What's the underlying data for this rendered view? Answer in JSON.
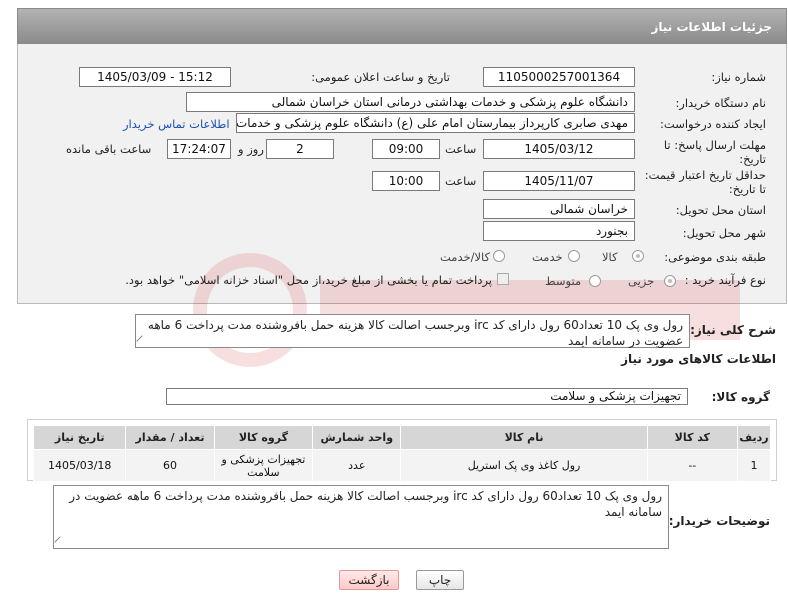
{
  "header": {
    "title": "جزئیات اطلاعات نیاز"
  },
  "need_number": {
    "label": "شماره نیاز:",
    "value": "1105000257001364"
  },
  "announce_datetime": {
    "label": "تاریخ و ساعت اعلان عمومی:",
    "value": "1405/03/09 - 15:12"
  },
  "buyer_org": {
    "label": "نام دستگاه خریدار:",
    "value": "دانشگاه علوم پزشکی و خدمات بهداشتی درمانی استان خراسان شمالی"
  },
  "requester": {
    "label": "ایجاد کننده درخواست:",
    "value": "مهدی صابری کارپرداز بیمارستان امام علی (ع) دانشگاه علوم پزشکی و خدمات ب",
    "contact_link": "اطلاعات تماس خریدار"
  },
  "reply_deadline": {
    "label": "مهلت ارسال پاسخ: تا تاریخ:",
    "date": "1405/03/12",
    "time_label": "ساعت",
    "time": "09:00",
    "days": "2",
    "days_label": "روز و",
    "remaining": "17:24:07",
    "remaining_label": "ساعت باقی مانده"
  },
  "price_validity": {
    "label": "حداقل تاریخ اعتبار قیمت: تا تاریخ:",
    "date": "1405/11/07",
    "time_label": "ساعت",
    "time": "10:00"
  },
  "delivery_province": {
    "label": "استان محل تحویل:",
    "value": "خراسان شمالی"
  },
  "delivery_city": {
    "label": "شهر محل تحویل:",
    "value": "بجنورد"
  },
  "category": {
    "label": "طبقه بندی موضوعی:",
    "options": [
      "کالا",
      "خدمت",
      "کالا/خدمت"
    ],
    "selected": "کالا"
  },
  "process_type": {
    "label": "نوع فرآیند خرید :",
    "options": [
      "جزیی",
      "متوسط"
    ],
    "selected": "جزیی",
    "treasury_note": "پرداخت تمام یا بخشی از مبلغ خرید،از محل \"اسناد خزانه اسلامی\" خواهد بود."
  },
  "general_description": {
    "label": "شرح کلی نیاز:",
    "value": "رول وی پک 10 تعداد60 رول دارای کد irc وبرجسب اصالت کالا هزینه حمل بافروشنده مدت پرداخت 6 ماهه عضویت در سامانه ایمد"
  },
  "goods_info_title": "اطلاعات کالاهای مورد نیاز",
  "goods_group": {
    "label": "گروه کالا:",
    "value": "تجهیزات پزشکی و سلامت"
  },
  "table": {
    "headers": [
      "ردیف",
      "کد کالا",
      "نام کالا",
      "واحد شمارش",
      "گروه کالا",
      "تعداد / مقدار",
      "تاریخ نیاز"
    ],
    "rows": [
      [
        "1",
        "--",
        "رول کاغذ وی پک استریل",
        "عدد",
        "تجهیزات پزشکی و سلامت",
        "60",
        "1405/03/18"
      ]
    ]
  },
  "buyer_notes": {
    "label": "توضیحات خریدار:",
    "value": "رول وی پک 10 تعداد60 رول دارای کد irc وبرجسب اصالت کالا هزینه حمل بافروشنده مدت پرداخت 6 ماهه عضویت در سامانه ایمد"
  },
  "buttons": {
    "print": "چاپ",
    "back": "بازگشت"
  },
  "colors": {
    "header_bg": "#9d9d9d",
    "link": "#1b4fb5",
    "back_button": "#ffc9c9"
  }
}
